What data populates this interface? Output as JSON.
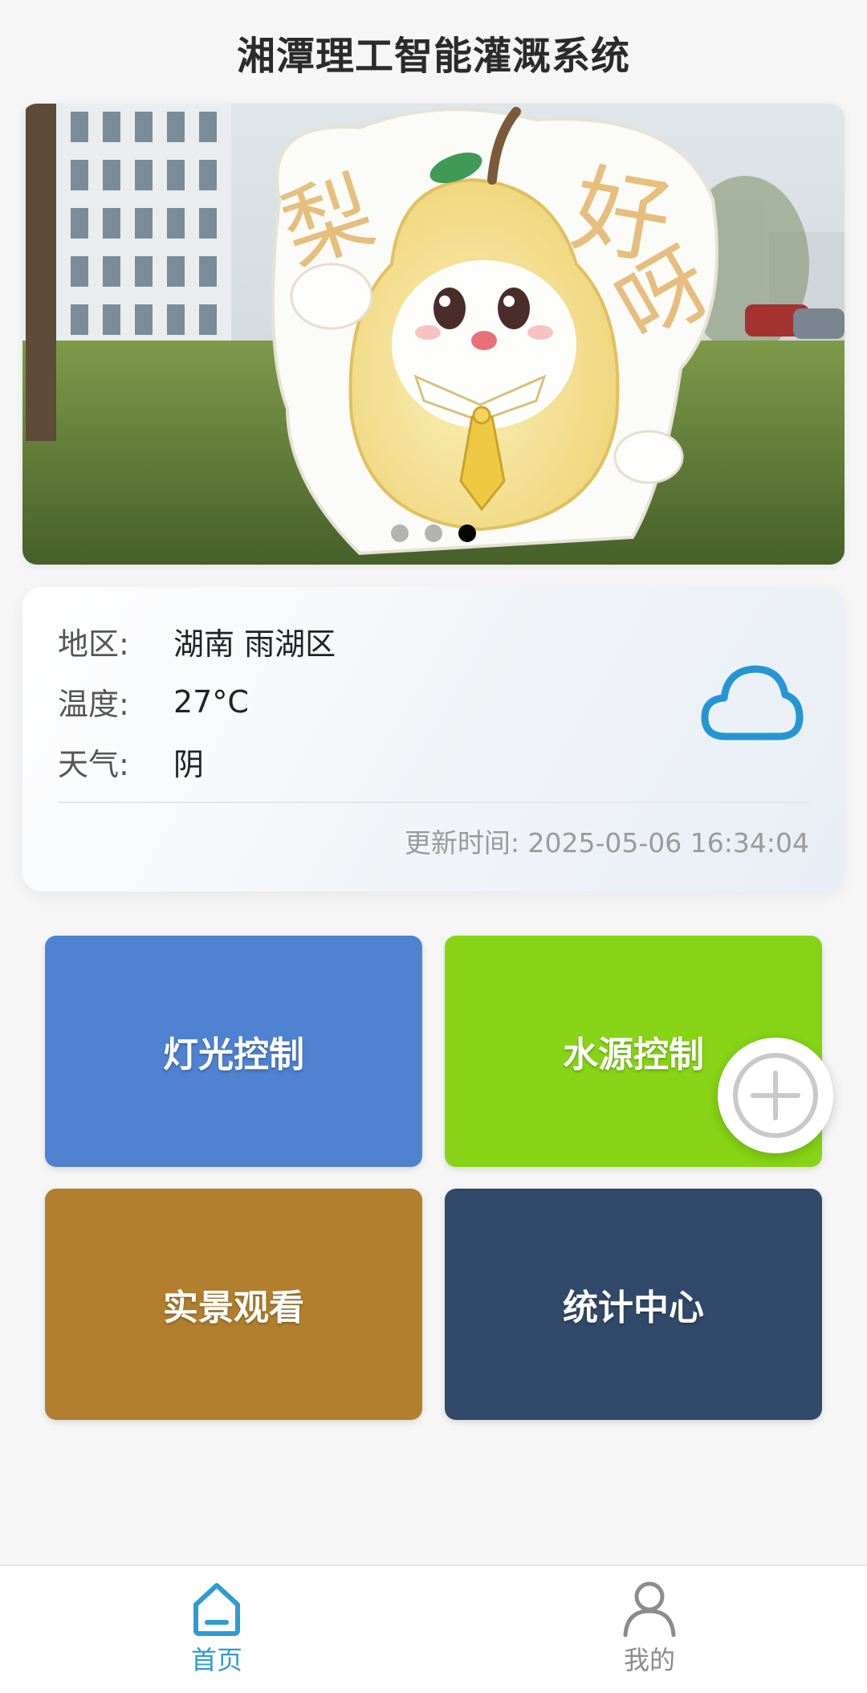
{
  "header": {
    "title": "湘潭理工智能灌溉系统"
  },
  "banner": {
    "sign_text": "梨 好 呀",
    "slides": 3,
    "active_slide": 3
  },
  "weather": {
    "region_label": "地区:",
    "region_value": "湖南 雨湖区",
    "temp_label": "温度:",
    "temp_value": "27°C",
    "weather_label": "天气:",
    "weather_value": "阴",
    "updated": "更新时间: 2025-05-06 16:34:04",
    "icon": "cloud-icon",
    "icon_color": "#2596d4"
  },
  "tiles": [
    {
      "label": "灯光控制",
      "color": "#4f82d0"
    },
    {
      "label": "水源控制",
      "color": "#86d415"
    },
    {
      "label": "实景观看",
      "color": "#b17f2d"
    },
    {
      "label": "统计中心",
      "color": "#314a69"
    }
  ],
  "fab": {
    "icon": "plus-icon"
  },
  "tabbar": {
    "home_label": "首页",
    "home_icon": "home-icon",
    "active_color": "#2f9bd4",
    "me_label": "我的",
    "me_icon": "user-icon",
    "inactive_color": "#8c8c8c"
  }
}
